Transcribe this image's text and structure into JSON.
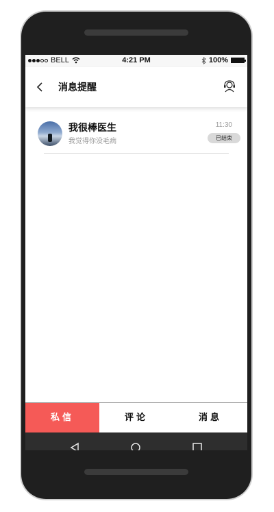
{
  "status_bar": {
    "carrier": "BELL",
    "time": "4:21 PM",
    "battery": "100%"
  },
  "header": {
    "title": "消息提醒",
    "back_icon": "chevron-left-icon",
    "support_icon": "headset-icon"
  },
  "messages": [
    {
      "name": "我很棒医生",
      "preview": "我觉得你没毛病",
      "time": "11:30",
      "status": "已结束"
    }
  ],
  "tabs": [
    {
      "label": "私信",
      "active": true
    },
    {
      "label": "评论",
      "active": false
    },
    {
      "label": "消息",
      "active": false
    }
  ],
  "colors": {
    "accent": "#f55a57",
    "device_body": "#1f1f1f",
    "nav_bar": "#2e2e2e"
  }
}
